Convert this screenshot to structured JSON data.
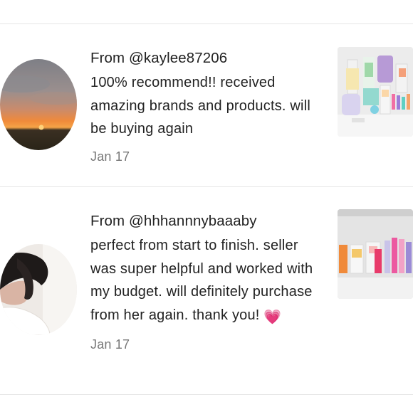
{
  "reviews": [
    {
      "from": "From @kaylee87206",
      "text": "100% recommend!! received amazing brands and products. will be buying again",
      "date": "Jan 17",
      "avatar_icon": "sunset-avatar",
      "thumbnail_icon": "skincare-products-photo"
    },
    {
      "from": "From @hhhannnybaaaby",
      "text": "perfect from start to finish. seller was super helpful and worked with my budget. will definitely purchase from her again. thank you!",
      "emoji": "💗",
      "date": "Jan 17",
      "avatar_icon": "person-avatar",
      "thumbnail_icon": "skincare-products-photo"
    }
  ],
  "colors": {
    "text": "#222222",
    "date": "#777777",
    "divider": "#e6e6e6",
    "heart": "#f06ba8"
  }
}
